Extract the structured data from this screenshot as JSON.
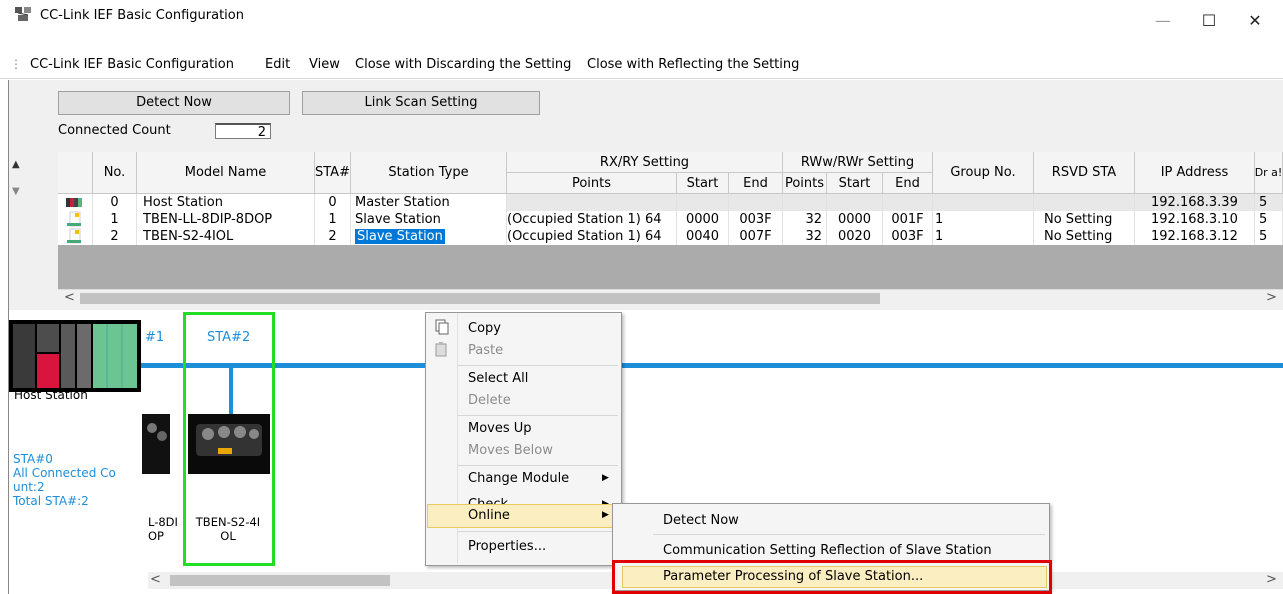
{
  "window": {
    "title": "CC-Link IEF Basic Configuration",
    "minimize": "—",
    "maximize": "☐",
    "close": "✕"
  },
  "menu": [
    "CC-Link IEF Basic Configuration",
    "Edit",
    "View",
    "Close with Discarding the Setting",
    "Close with Reflecting the Setting"
  ],
  "toolbar": {
    "detect_now": "Detect Now",
    "link_scan": "Link Scan Setting",
    "connected_label": "Connected Count",
    "connected_value": "2"
  },
  "grid": {
    "headers": {
      "no": "No.",
      "model": "Model Name",
      "sta": "STA#",
      "type": "Station Type",
      "rxry": "RX/RY Setting",
      "rww": "RWw/RWr Setting",
      "points": "Points",
      "start": "Start",
      "end": "End",
      "group": "Group No.",
      "rsvd": "RSVD STA",
      "ip": "IP Address",
      "cut": "Dr a!"
    },
    "rows": [
      {
        "no": "0",
        "model": "Host Station",
        "sta": "0",
        "type": "Master Station",
        "rx_points": "",
        "rx_start": "",
        "rx_end": "",
        "rw_points": "",
        "rw_start": "",
        "rw_end": "",
        "group": "",
        "rsvd": "",
        "ip": "192.168.3.39",
        "extra": "5"
      },
      {
        "no": "1",
        "model": "TBEN-LL-8DIP-8DOP",
        "sta": "1",
        "type": "Slave Station",
        "rx_points": "64 (1 Occupied Station)",
        "rx_start": "0000",
        "rx_end": "003F",
        "rw_points": "32",
        "rw_start": "0000",
        "rw_end": "001F",
        "group": "1",
        "rsvd": "No Setting",
        "ip": "192.168.3.10",
        "extra": "5"
      },
      {
        "no": "2",
        "model": "TBEN-S2-4IOL",
        "sta": "2",
        "type": "Slave Station",
        "rx_points": "64 (1 Occupied Station)",
        "rx_start": "0040",
        "rx_end": "007F",
        "rw_points": "32",
        "rw_start": "0020",
        "rw_end": "003F",
        "group": "1",
        "rsvd": "No Setting",
        "ip": "192.168.3.12",
        "extra": "5"
      }
    ]
  },
  "diagram": {
    "host_label": "Host Station",
    "sta1": "#1",
    "sta2": "STA#2",
    "info": [
      "STA#0",
      "All Connected Co",
      "unt:2",
      "Total STA#:2"
    ],
    "dev1_label": [
      "L-8DI",
      "OP"
    ],
    "dev2_label": [
      "TBEN-S2-4I",
      "OL"
    ]
  },
  "context_menu": {
    "copy": "Copy",
    "paste": "Paste",
    "select_all": "Select All",
    "delete": "Delete",
    "moves_up": "Moves Up",
    "moves_below": "Moves Below",
    "change_module": "Change Module",
    "check": "Check",
    "online": "Online",
    "properties": "Properties..."
  },
  "submenu": {
    "detect_now": "Detect Now",
    "comm_reflect": "Communication Setting Reflection of Slave Station",
    "param_processing": "Parameter Processing of Slave Station..."
  }
}
